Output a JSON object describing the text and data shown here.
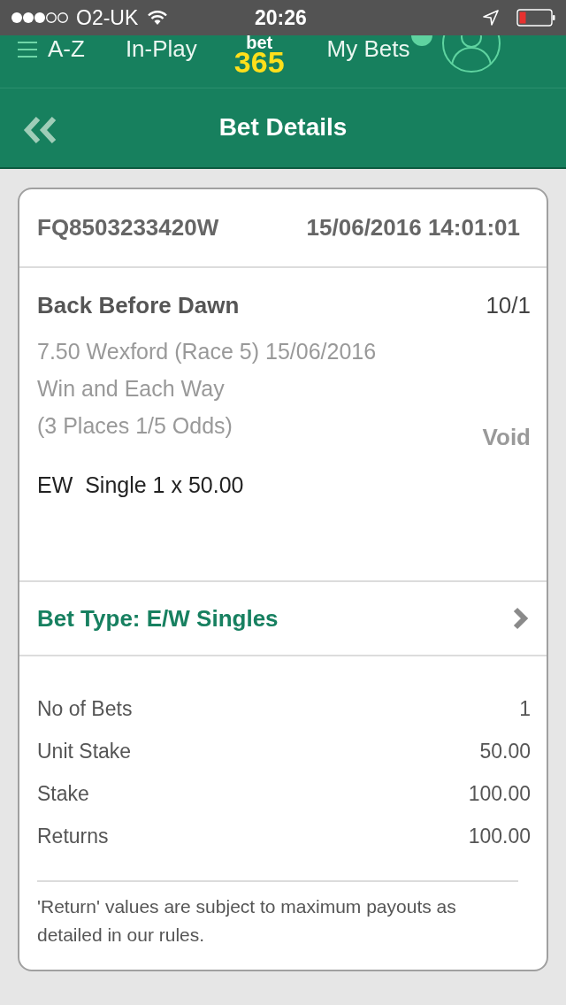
{
  "status_bar": {
    "carrier": "O2-UK",
    "time": "20:26"
  },
  "top_nav": {
    "menu_label": "A-Z",
    "links": [
      {
        "label": "In-Play",
        "selected": false
      }
    ],
    "logo": {
      "word": "bet",
      "number": "365"
    },
    "my_bets": "My Bets"
  },
  "title_bar": {
    "title": "Bet Details"
  },
  "bet": {
    "reference": "FQ8503233420W",
    "placed": "15/06/2016 14:01:01",
    "selection": {
      "name": "Back Before Dawn",
      "odds": "10/1",
      "details": [
        "7.50 Wexford (Race 5) 15/06/2016",
        "Win and Each Way",
        "(3 Places 1/5 Odds)"
      ],
      "result": "Void",
      "stake_line": "EW  Single 1 x 50.00"
    },
    "bet_type": "Bet Type: E/W Singles",
    "summary": [
      {
        "label": "No of Bets",
        "value": "1"
      },
      {
        "label": "Unit Stake",
        "value": "50.00"
      },
      {
        "label": "Stake",
        "value": "100.00"
      },
      {
        "label": "Returns",
        "value": "100.00"
      }
    ],
    "note": "'Return' values are subject to maximum payouts as detailed in our rules."
  }
}
